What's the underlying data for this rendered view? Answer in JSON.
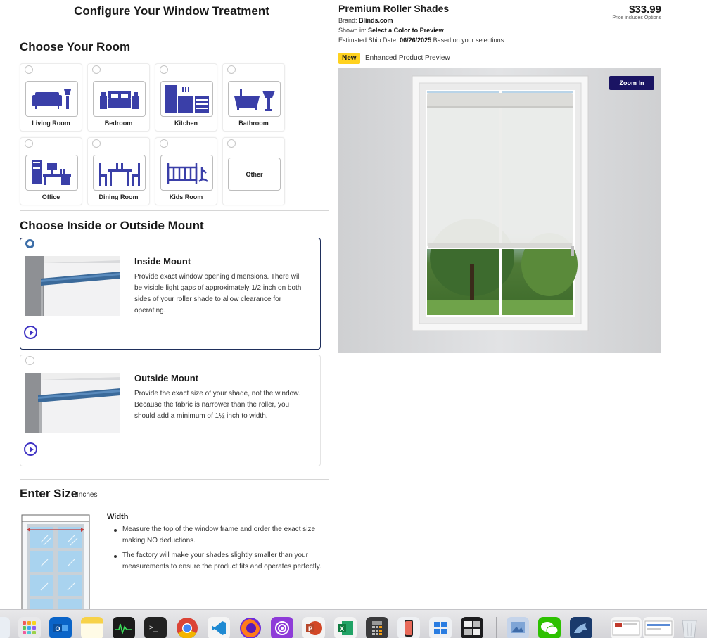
{
  "configure_title": "Configure Your Window Treatment",
  "room": {
    "title": "Choose Your Room",
    "items": [
      {
        "label": "Living Room",
        "icon": "sofa-icon"
      },
      {
        "label": "Bedroom",
        "icon": "bed-icon"
      },
      {
        "label": "Kitchen",
        "icon": "kitchen-icon"
      },
      {
        "label": "Bathroom",
        "icon": "bathtub-icon"
      },
      {
        "label": "Office",
        "icon": "desk-icon"
      },
      {
        "label": "Dining Room",
        "icon": "dining-table-icon"
      },
      {
        "label": "Kids Room",
        "icon": "crib-icon"
      },
      {
        "label": "Other",
        "icon": ""
      }
    ]
  },
  "mount": {
    "title": "Choose Inside or Outside Mount",
    "options": [
      {
        "title": "Inside Mount",
        "description": "Provide exact window opening dimensions. There will be visible light gaps of approximately 1/2 inch on both sides of your roller shade to allow clearance for operating.",
        "selected": true
      },
      {
        "title": "Outside Mount",
        "description": "Provide the exact size of your shade, not the window. Because the fabric is narrower than the roller, you should add a minimum of 1½ inch to width.",
        "selected": false
      }
    ]
  },
  "size": {
    "title": "Enter Size",
    "unit": "Inches",
    "width_heading": "Width",
    "width_tips": [
      "Measure the top of the window frame and order the exact size making NO deductions.",
      "The factory will make your shades slightly smaller than your measurements to ensure the product fits and operates perfectly."
    ]
  },
  "product": {
    "title": "Premium Roller Shades",
    "brand_label": "Brand:",
    "brand": "Blinds.com",
    "shown_label": "Shown in:",
    "shown_value": "Select a Color to Preview",
    "ship_label": "Estimated Ship Date:",
    "ship_date": "06/26/2025",
    "ship_suffix": "Based on your selections",
    "price": "$33.99",
    "price_note": "Price includes Options",
    "badge": "New",
    "preview_label": "Enhanced Product Preview",
    "zoom_label": "Zoom In"
  },
  "dock": [
    "finder-icon",
    "launchpad-icon",
    "outlook-icon",
    "notes-icon",
    "activity-monitor-icon",
    "terminal-icon",
    "chrome-icon",
    "vscode-icon",
    "firefox-icon",
    "podcast-icon",
    "powerpoint-icon",
    "excel-icon",
    "calculator-icon",
    "phone-mirror-icon",
    "windows-app-icon",
    "multi-window-icon",
    "preview-icon",
    "wechat-icon",
    "mysql-workbench-icon",
    "window-thumbnail-icon",
    "window-thumbnail-2-icon",
    "trash-icon"
  ],
  "colors": {
    "accent": "#3a3fa8",
    "zoom_button": "#1a1463",
    "badge": "#ffd21f",
    "selected_border": "#1f2f5c"
  }
}
